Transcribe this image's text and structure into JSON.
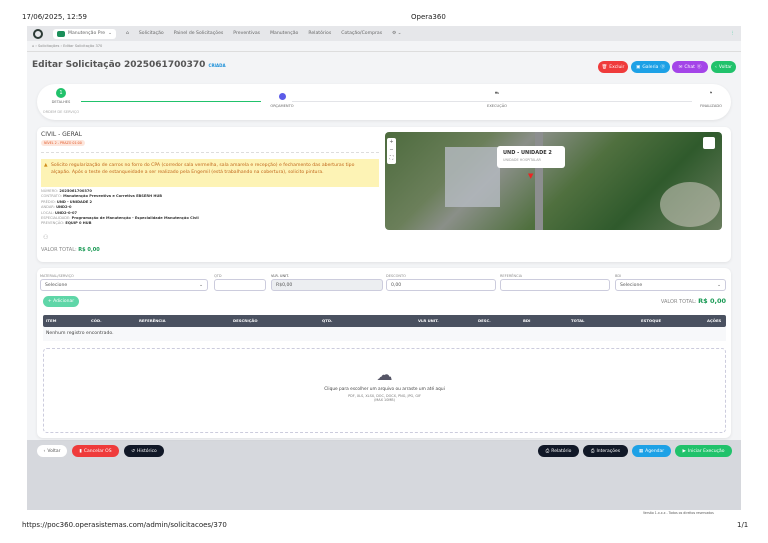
{
  "print_header": {
    "datetime": "17/06/2025, 12:59",
    "title": "Opera360"
  },
  "nav": {
    "contract_select": "Manutenção Pre",
    "items": [
      "Solicitação",
      "Painel de Solicitações",
      "Preventivas",
      "Manutenção",
      "Relatórios",
      "Cotação/Compras"
    ]
  },
  "breadcrumb": [
    "Solicitações",
    "Editar Solicitação 370"
  ],
  "page": {
    "title": "Editar Solicitação 2025061700370",
    "status": "CRIADA"
  },
  "header_buttons": {
    "delete": "Excluir",
    "gallery": "Galeria",
    "chat": "Chat",
    "back": "Voltar"
  },
  "stepper": {
    "steps": [
      {
        "label": "DETALHES",
        "sub": "ORDEM DE SERVIÇO",
        "number": "1"
      },
      {
        "label": "ORÇAMENTO"
      },
      {
        "label": "EXECUÇÃO"
      },
      {
        "label": "FINALIZADO"
      }
    ]
  },
  "details": {
    "category": "CIVIL - GERAL",
    "priority_tag": "NÍVEL 2 - PRAZO 01:00",
    "description": "Solicito regularização de carros no forro do CPA (corredor sala vermelha, sala amarela e recepção) e fechamento das aberturas tipo alçapão. Após o teste de estanqueidade a ser realizado pela Engemil (está trabalhando na cobertura), solicito pintura.",
    "fields": [
      {
        "k": "NÚMERO:",
        "v": "2025061700370"
      },
      {
        "k": "CONTRATO:",
        "v": "Manutenção Preventiva e Corretiva EBSERH HUB"
      },
      {
        "k": "PRÉDIO:",
        "v": "UND - UNIDADE 2"
      },
      {
        "k": "ANDAR:",
        "v": "UND2-0"
      },
      {
        "k": "LOCAL:",
        "v": "UND2-0-07"
      },
      {
        "k": "ESPECIALIDADE:",
        "v": "Programação de Manutenção - Especialidade Manutenção Civil"
      },
      {
        "k": "PREVENÇÃO:",
        "v": "EQUIP 0 HUB"
      }
    ],
    "total_label": "VALOR TOTAL:",
    "total_value": "R$ 0,00"
  },
  "map": {
    "popup_title": "UND - UNIDADE 2",
    "popup_sub": "UNIDADE HOSPITALAR"
  },
  "items_form": {
    "material_label": "MATERIAL/SERVIÇO",
    "material_value": "Selecione",
    "qty_label": "QTD",
    "unit_label": "VLR. UNIT.",
    "unit_value": "R$0,00",
    "discount_label": "DESCONTO",
    "discount_value": "0,00",
    "reference_label": "REFERÊNCIA",
    "bdi_label": "BDI",
    "bdi_value": "Selecione",
    "add_button": "+ Adicionar",
    "total_label": "VALOR TOTAL:",
    "total_value": "R$ 0,00"
  },
  "table": {
    "headers": [
      "ITEM",
      "CÓD.",
      "REFERÊNCIA",
      "DESCRIÇÃO",
      "QTD.",
      "VLR UNIT.",
      "DESC.",
      "BDI",
      "TOTAL",
      "ESTOQUE",
      "AÇÕES"
    ],
    "empty": "Nenhum registro encontrado."
  },
  "upload": {
    "text": "Clique para escolher um arquivo ou arraste um até aqui",
    "formats": "PDF, XLS, XLSX, DOC, DOCX, PNG, JPG, GIF",
    "max": "(MAX 10MB)"
  },
  "footer_buttons": {
    "back": "Voltar",
    "cancel": "Cancelar OS",
    "history": "Histórico",
    "report": "Relatório",
    "interactions": "Interações",
    "schedule": "Agendar",
    "start": "Iniciar Execução"
  },
  "footer_text": "Versão 1.x.x.x - Todos os direitos reservados",
  "print_footer": {
    "url": "https://poc360.operasistemas.com/admin/solicitacoes/370",
    "page": "1/1"
  },
  "colors": {
    "green": "#21c26b",
    "red": "#ef3b3b",
    "blue": "#1da1e6",
    "purple": "#a444e8",
    "dark": "#111827",
    "header_table": "#4a5160"
  }
}
